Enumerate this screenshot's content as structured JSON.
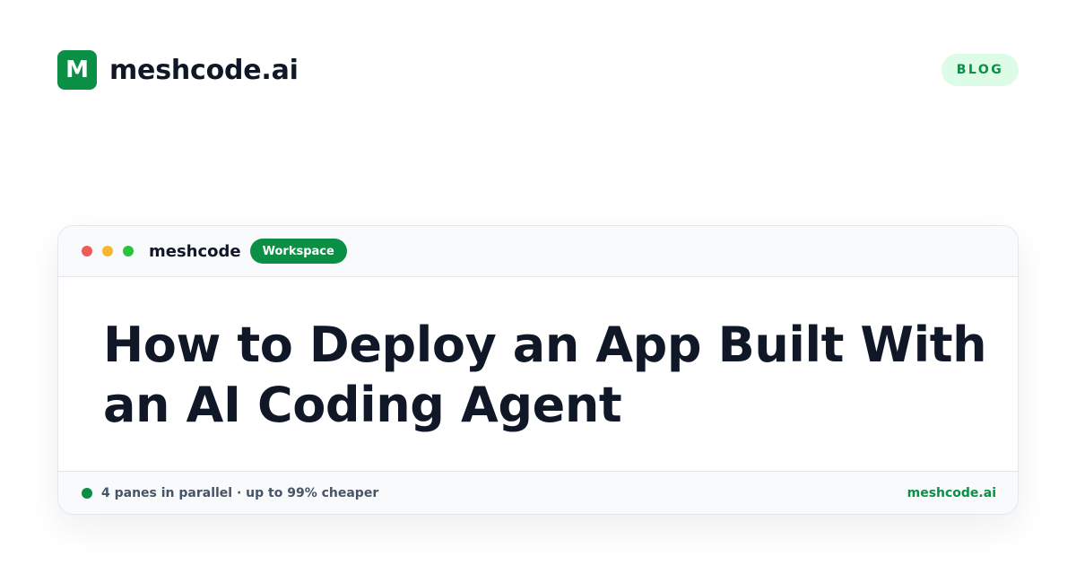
{
  "brand": {
    "logo_letter": "M",
    "name": "meshcode.ai"
  },
  "badge": {
    "label": "BLOG"
  },
  "window": {
    "title": "meshcode",
    "workspace_badge": "Workspace",
    "headline": "How to Deploy an App Built With an AI Coding Agent"
  },
  "statusbar": {
    "text": "4 panes in parallel · up to 99% cheaper",
    "link": "meshcode.ai"
  },
  "colors": {
    "accent": "#0a8f45",
    "badge_bg": "#dcfce7",
    "text_dark": "#101828",
    "text_muted": "#475467",
    "traffic_red": "#ef5b55",
    "traffic_yellow": "#f5b82e",
    "traffic_green": "#27c341"
  }
}
